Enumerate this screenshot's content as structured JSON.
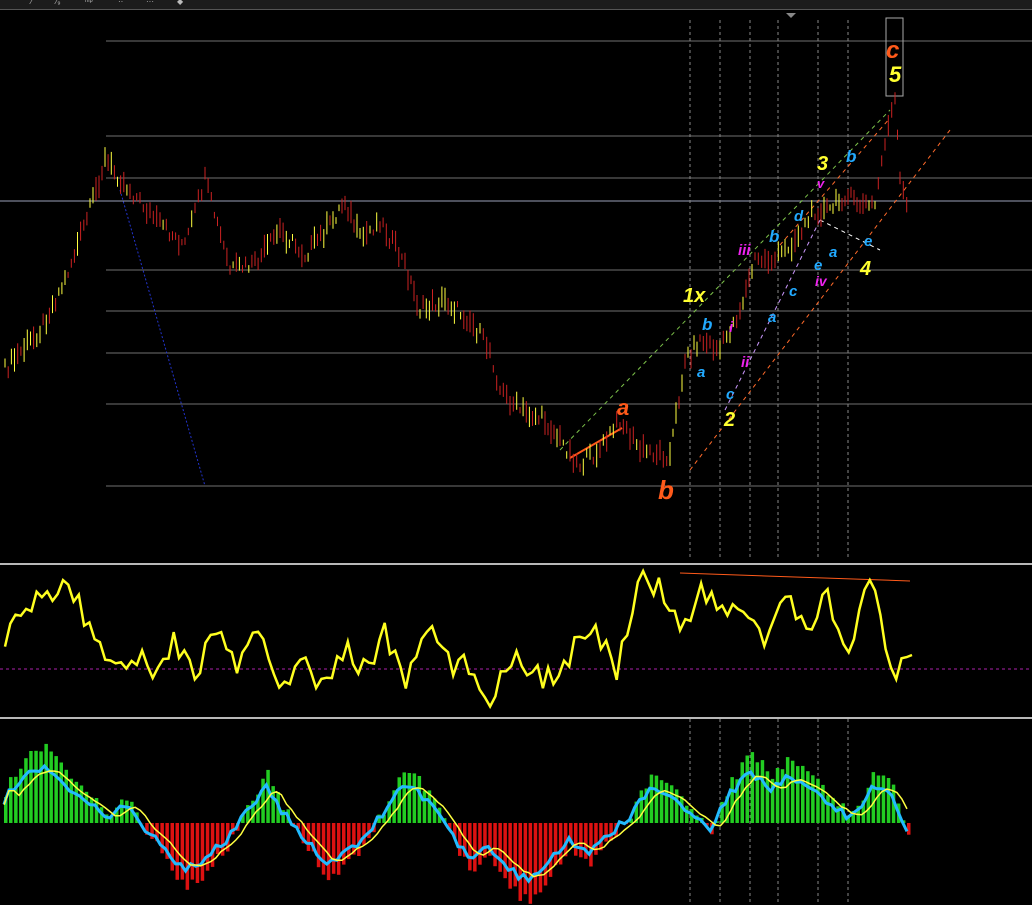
{
  "toolbar": {
    "items": [
      "⁄",
      "⁄₉",
      "ᵐᵖ",
      "··",
      "···",
      "◆"
    ]
  },
  "colors": {
    "background": "#000000",
    "bull_bar": "#ffff40",
    "bear_bar": "#cc2222",
    "grid": "#7a7a7a",
    "wave_primary": "#ff5a1a",
    "wave_intermediate": "#ffff30",
    "wave_minor": "#22aaff",
    "wave_minute": "#ee22ee",
    "oscillator": "#ffff20",
    "macd_positive": "#22cc22",
    "macd_negative": "#dd1111",
    "macd_line": "#22bbff",
    "signal_line": "#ffff40"
  },
  "wave_labels": {
    "primary": [
      "a",
      "b",
      "c"
    ],
    "intermediate": [
      "1x",
      "2",
      "3",
      "4",
      "5"
    ],
    "minor": [
      "a",
      "b",
      "c",
      "a",
      "b",
      "c",
      "d",
      "e",
      "a",
      "b",
      "c",
      "e"
    ],
    "minute": [
      "i",
      "ii",
      "iii",
      "iv",
      "v"
    ]
  },
  "chart_data": [
    {
      "type": "candlestick",
      "panel": "price",
      "grid": true,
      "horizontal_levels": 9,
      "wave_count": "Elliott a-b-c with 1x-2-3-4-5 impulse in wave c"
    },
    {
      "type": "line",
      "panel": "oscillator",
      "series": [
        {
          "values": [
            0.55,
            0.7,
            0.85,
            0.9,
            0.6,
            0.35,
            0.4,
            0.3,
            0.5,
            0.25,
            0.6,
            0.3,
            0.55,
            0.2,
            0.35,
            0.15,
            0.45,
            0.3,
            0.55,
            0.2,
            0.6,
            0.35,
            0.3,
            0.1,
            0.4,
            0.3,
            0.2,
            0.45,
            0.55,
            0.3,
            0.95,
            0.9,
            0.6,
            0.85,
            0.7,
            0.75,
            0.5,
            0.8,
            0.55,
            0.85,
            0.4,
            0.95,
            0.25,
            0.4
          ]
        }
      ]
    },
    {
      "type": "bar",
      "panel": "macd",
      "series": [
        {
          "values": [
            0.4,
            0.8,
            1.0,
            0.7,
            0.4,
            0.1,
            0.3,
            -0.1,
            -0.5,
            -0.8,
            -0.6,
            -0.3,
            0.2,
            0.6,
            0.1,
            -0.3,
            -0.7,
            -0.5,
            -0.2,
            0.3,
            0.7,
            0.4,
            -0.1,
            -0.6,
            -0.4,
            -0.8,
            -1.0,
            -0.7,
            -0.3,
            -0.5,
            -0.2,
            0.1,
            0.6,
            0.5,
            0.2,
            -0.1,
            0.5,
            0.9,
            0.6,
            0.8,
            0.6,
            0.3,
            0.1,
            0.6,
            0.5,
            -0.4
          ]
        }
      ]
    }
  ]
}
